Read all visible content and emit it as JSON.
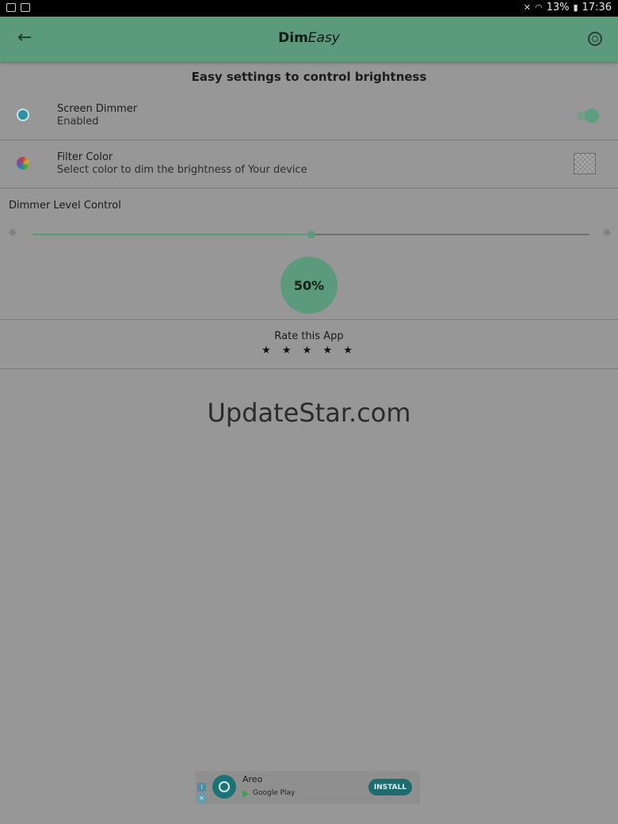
{
  "status_bar": {
    "battery": "13%",
    "time": "17:36",
    "icons": [
      "screen-record-icon",
      "image-icon",
      "mute-icon",
      "wifi-icon",
      "battery-icon"
    ]
  },
  "app_bar": {
    "title_bold": "Dim",
    "title_italic": "Easy",
    "back_icon": "arrow-left-icon",
    "settings_icon": "settings-icon",
    "color": "#5b9a7a"
  },
  "subtitle": "Easy settings to control brightness",
  "screen_dimmer": {
    "title": "Screen Dimmer",
    "status": "Enabled",
    "enabled": true,
    "icon": "brightness-icon"
  },
  "filter_color": {
    "title": "Filter Color",
    "subtitle": "Select color to dim the brightness of Your device",
    "icon": "color-wheel-icon"
  },
  "dimmer": {
    "label": "Dimmer Level Control",
    "level": 0.5,
    "level_text": "50%"
  },
  "rating": {
    "label": "Rate this App",
    "stars": "★ ★ ★ ★ ★"
  },
  "watermark": "UpdateStar.com",
  "ad": {
    "app_name": "Areo",
    "store": "Google Play",
    "install": "INSTALL",
    "info_glyph": "i",
    "close_glyph": "✕"
  }
}
